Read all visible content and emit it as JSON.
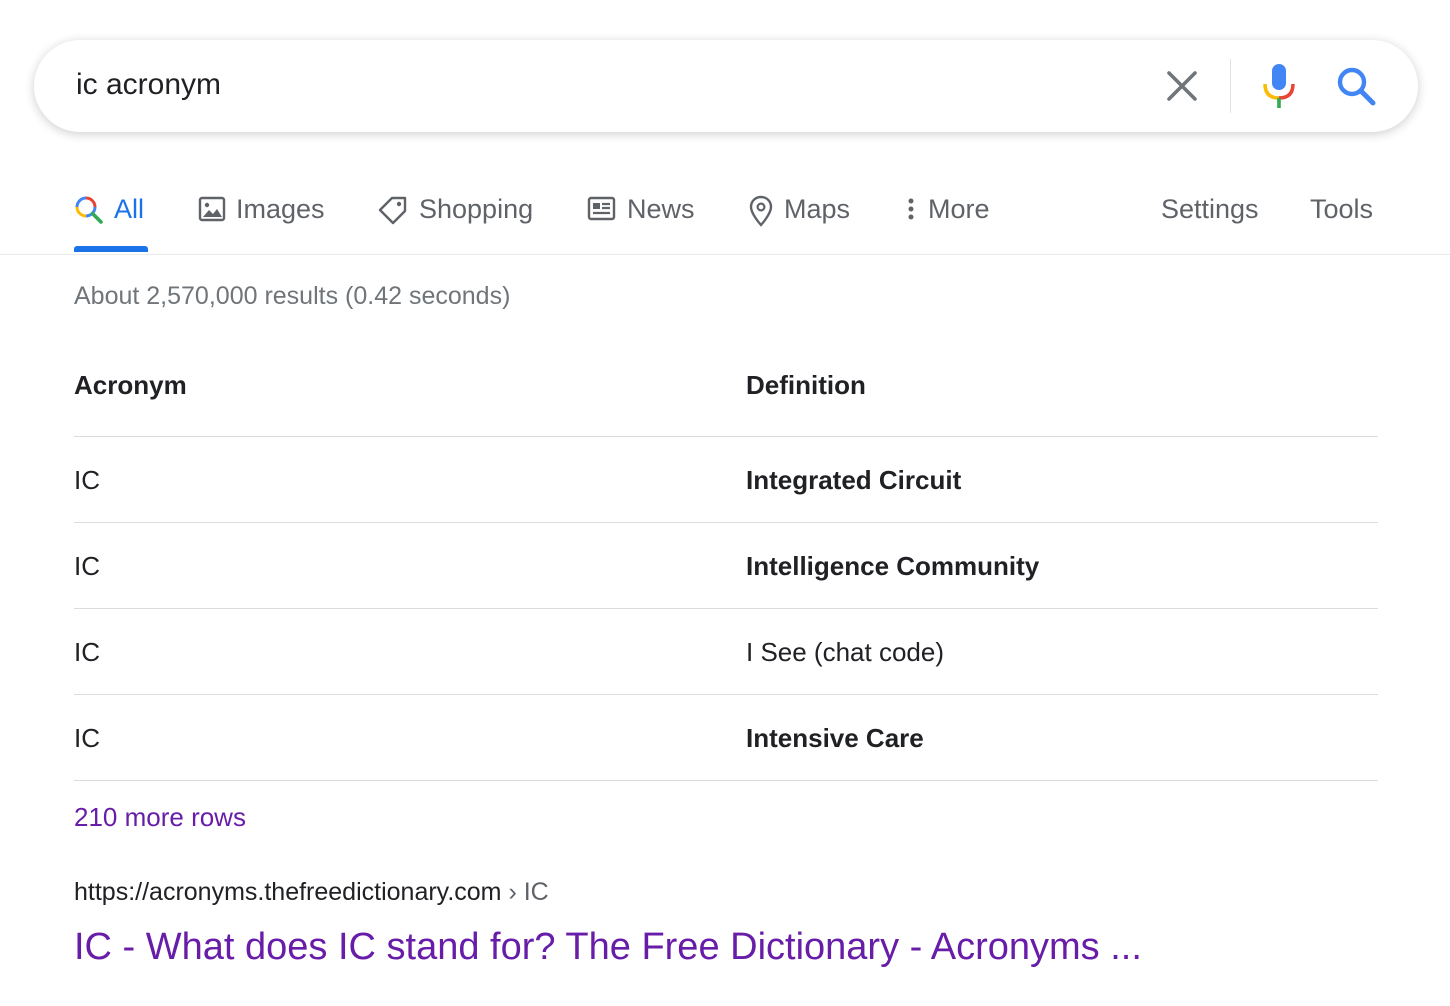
{
  "search": {
    "query": "ic acronym",
    "placeholder": "",
    "clear_icon": "close-icon",
    "mic_icon": "microphone-icon",
    "search_icon": "search-icon"
  },
  "tabs": [
    {
      "label": "All",
      "icon": "search-icon",
      "active": true
    },
    {
      "label": "Images",
      "icon": "image-icon"
    },
    {
      "label": "Shopping",
      "icon": "tag-icon"
    },
    {
      "label": "News",
      "icon": "news-icon"
    },
    {
      "label": "Maps",
      "icon": "map-pin-icon"
    },
    {
      "label": "More",
      "icon": "more-vertical-icon"
    }
  ],
  "tools": {
    "settings_label": "Settings",
    "tools_label": "Tools"
  },
  "stats": "About 2,570,000 results (0.42 seconds)",
  "snippet_table": {
    "headers": [
      "Acronym",
      "Definition"
    ],
    "rows": [
      {
        "acronym": "IC",
        "definition": "Integrated Circuit",
        "bold": true
      },
      {
        "acronym": "IC",
        "definition": "Intelligence Community",
        "bold": true
      },
      {
        "acronym": "IC",
        "definition": "I See (chat code)",
        "bold": false
      },
      {
        "acronym": "IC",
        "definition": "Intensive Care",
        "bold": true
      }
    ],
    "more_rows_label": "210 more rows"
  },
  "result": {
    "url": "https://acronyms.thefreedictionary.com",
    "breadcrumb": " › IC",
    "title": "IC - What does IC stand for? The Free Dictionary - Acronyms ..."
  },
  "colors": {
    "accent": "#1a73e8",
    "visited_link": "#681da8",
    "muted_text": "#70757a"
  }
}
